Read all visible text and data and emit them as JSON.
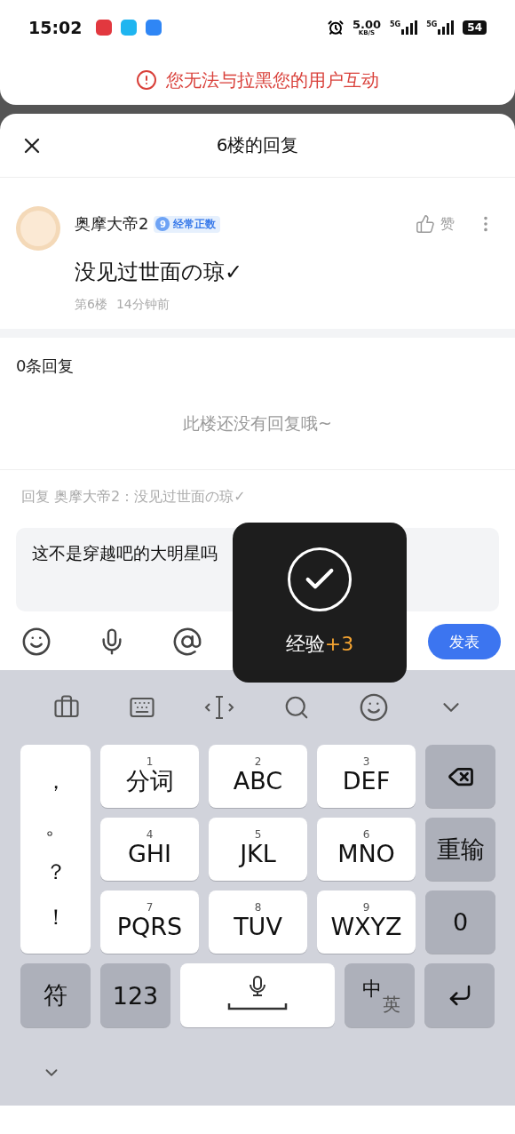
{
  "status_bar": {
    "time": "15:02",
    "net_speed": "5.00",
    "net_unit": "KB/S",
    "networks": [
      "5G",
      "5G"
    ],
    "battery": "54"
  },
  "banner": {
    "text": "您无法与拉黑您的用户互动"
  },
  "sheet": {
    "title": "6楼的回复"
  },
  "post": {
    "author": "奥摩大帝2",
    "level": "9",
    "badge": "经常正数",
    "like": "赞",
    "content": "没见过世面の琼✓",
    "floor": "第6楼",
    "time": "14分钟前"
  },
  "replies": {
    "count": "0条回复",
    "empty": "此楼还没有回复哦~"
  },
  "composer": {
    "hint": "回复 奥摩大帝2：没见过世面の琼✓",
    "value": "这不是穿越吧的大明星吗",
    "send": "发表"
  },
  "toast": {
    "label": "经验",
    "bonus": "+3"
  },
  "keyboard": {
    "punctuation": [
      "，",
      "。",
      "？",
      "！"
    ],
    "keys": [
      {
        "number": "1",
        "label": "分词"
      },
      {
        "number": "2",
        "label": "ABC"
      },
      {
        "number": "3",
        "label": "DEF"
      },
      {
        "number": "4",
        "label": "GHI"
      },
      {
        "number": "5",
        "label": "JKL"
      },
      {
        "number": "6",
        "label": "MNO"
      },
      {
        "number": "7",
        "label": "PQRS"
      },
      {
        "number": "8",
        "label": "TUV"
      },
      {
        "number": "9",
        "label": "WXYZ"
      }
    ],
    "side_keys": [
      {
        "kind": "delete"
      },
      {
        "kind": "text",
        "label": "重输"
      },
      {
        "kind": "text",
        "label": "0"
      }
    ],
    "symbols": "符",
    "numbers": "123",
    "lang": {
      "main": "中",
      "alt": "英"
    }
  }
}
